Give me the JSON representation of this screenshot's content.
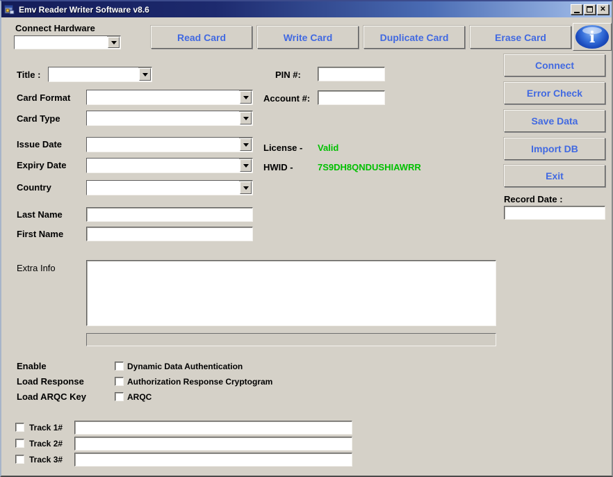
{
  "window": {
    "title": "Emv Reader Writer Software v8.6",
    "close_glyph": "✕"
  },
  "colors": {
    "accent_blue": "#4169e1",
    "valid_green": "#00c000",
    "titlebar_dark": "#141c58",
    "titlebar_light": "#a9c4ee",
    "face": "#d5d1c8"
  },
  "top": {
    "connect_hardware_label": "Connect Hardware",
    "connect_hardware_value": "",
    "buttons": [
      {
        "label": "Read Card"
      },
      {
        "label": "Write Card"
      },
      {
        "label": "Duplicate Card"
      },
      {
        "label": "Erase Card"
      }
    ],
    "info_icon_glyph": "i"
  },
  "form": {
    "title_label": "Title :",
    "title_value": "",
    "card_format_label": "Card Format",
    "card_format_value": "",
    "card_type_label": "Card Type",
    "card_type_value": "",
    "issue_date_label": "Issue Date",
    "issue_date_value": "",
    "expiry_date_label": "Expiry Date",
    "expiry_date_value": "",
    "country_label": "Country",
    "country_value": "",
    "last_name_label": "Last Name",
    "last_name_value": "",
    "first_name_label": "First Name",
    "first_name_value": "",
    "extra_info_label": "Extra Info",
    "extra_info_value": "",
    "pin_label": "PIN #:",
    "pin_value": "",
    "account_label": "Account #:",
    "account_value": ""
  },
  "status": {
    "license_label": "License -",
    "license_value": "Valid",
    "hwid_label": "HWID -",
    "hwid_value": "7S9DH8QNDUSHIAWRR"
  },
  "side": {
    "buttons": [
      {
        "label": "Connect"
      },
      {
        "label": "Error Check"
      },
      {
        "label": "Save Data"
      },
      {
        "label": "Import DB"
      },
      {
        "label": "Exit"
      }
    ],
    "record_date_label": "Record Date :",
    "record_date_value": ""
  },
  "options": {
    "rows": [
      {
        "caption": "Enable",
        "checkbox_label": "Dynamic Data Authentication",
        "checked": false
      },
      {
        "caption": "Load Response",
        "checkbox_label": "Authorization Response Cryptogram",
        "checked": false
      },
      {
        "caption": "Load ARQC Key",
        "checkbox_label": "ARQC",
        "checked": false
      }
    ]
  },
  "tracks": [
    {
      "label": "Track 1#",
      "value": "",
      "checked": false
    },
    {
      "label": "Track 2#",
      "value": "",
      "checked": false
    },
    {
      "label": "Track 3#",
      "value": "",
      "checked": false
    }
  ]
}
